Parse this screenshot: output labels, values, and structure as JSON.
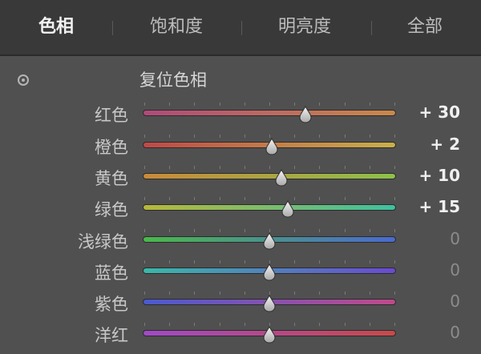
{
  "tabs": [
    {
      "label": "色相",
      "active": true
    },
    {
      "label": "饱和度",
      "active": false
    },
    {
      "label": "明亮度",
      "active": false
    },
    {
      "label": "全部",
      "active": false
    }
  ],
  "reset_label": "复位色相",
  "range": [
    -100,
    100
  ],
  "colors": {
    "panel_bg": "#505050",
    "tabbar_bg": "#393939",
    "value_text": "#f0f0f0",
    "zero_text": "#8c8c8c"
  },
  "sliders": [
    {
      "label": "红色",
      "value_text": "+ 30",
      "value": 30,
      "track": [
        "#b04a7a",
        "#c98a4a"
      ]
    },
    {
      "label": "橙色",
      "value_text": "+ 2",
      "value": 2,
      "track": [
        "#c04848",
        "#c9b04a"
      ]
    },
    {
      "label": "黄色",
      "value_text": "+ 10",
      "value": 10,
      "track": [
        "#c88a3a",
        "#8ec04a"
      ]
    },
    {
      "label": "绿色",
      "value_text": "+ 15",
      "value": 15,
      "track": [
        "#b8b83a",
        "#3ec0a0"
      ]
    },
    {
      "label": "浅绿色",
      "value_text": "0",
      "value": 0,
      "track": [
        "#4ab84a",
        "#4a6ad0"
      ]
    },
    {
      "label": "蓝色",
      "value_text": "0",
      "value": 0,
      "track": [
        "#3ab8a8",
        "#6a4ad0"
      ]
    },
    {
      "label": "紫色",
      "value_text": "0",
      "value": 0,
      "track": [
        "#4a5ad0",
        "#c04a8a"
      ]
    },
    {
      "label": "洋红",
      "value_text": "0",
      "value": 0,
      "track": [
        "#a04ac8",
        "#c84a4a"
      ]
    }
  ]
}
